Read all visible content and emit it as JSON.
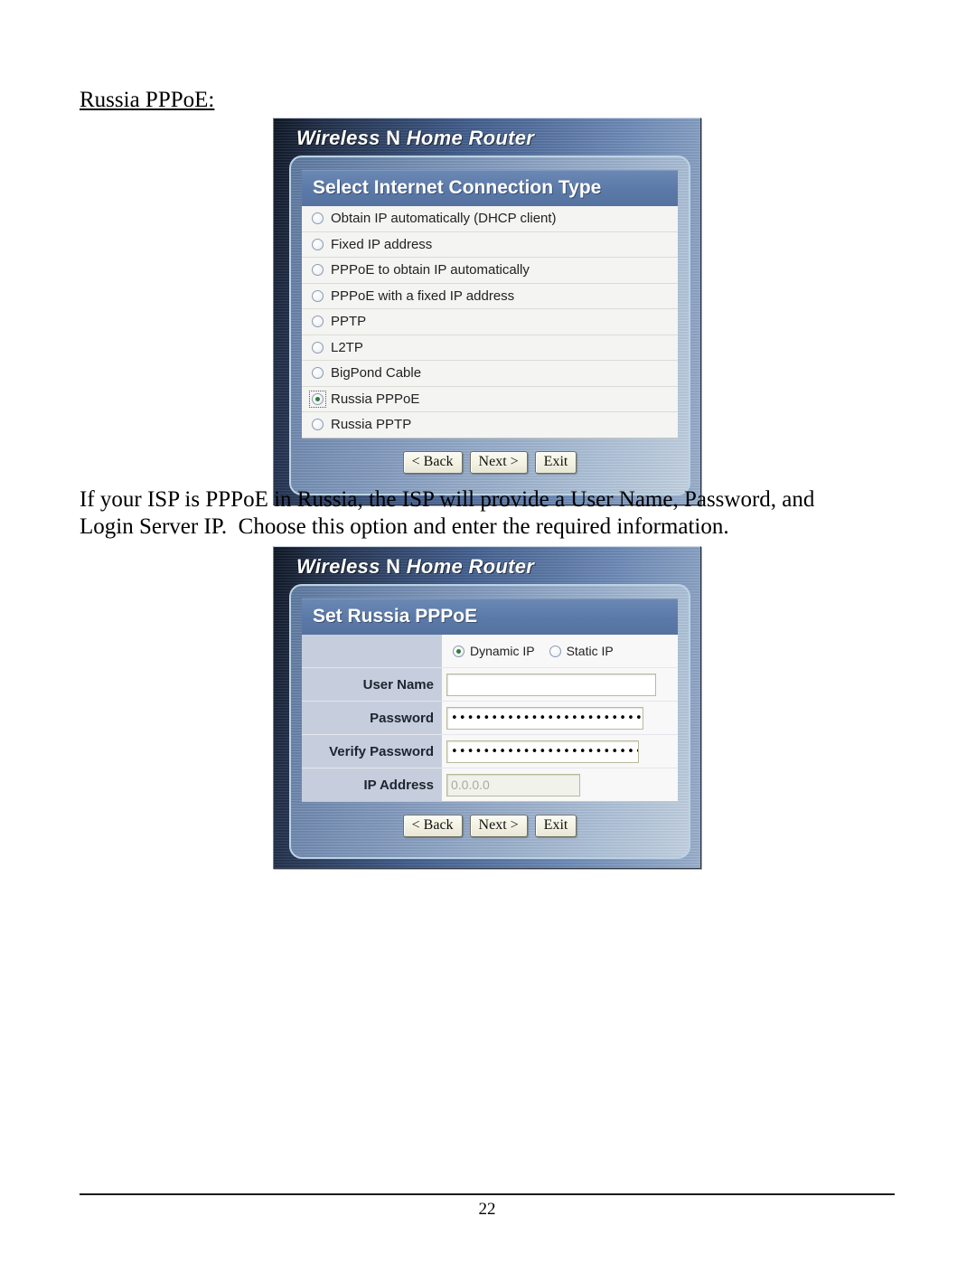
{
  "document": {
    "heading": "Russia PPPoE:",
    "paragraph_lines": [
      "If your ISP is PPPoE in Russia, the ISP will provide a User Name, Password, and",
      "Login Server IP.  Choose this option and enter the required information."
    ],
    "page_number": "22"
  },
  "colors": {
    "panel_header": "#5b79a8",
    "label_column": "#c6cedd",
    "window_dark": "#101826",
    "window_light": "#9db2ce",
    "radio_dot": "#2f7a3c",
    "input_border": "#b9b99a"
  },
  "dialog_connection_type": {
    "brand": {
      "prefix": "Wireless ",
      "n": "N",
      "suffix": " Home Router"
    },
    "panel_title": "Select Internet Connection Type",
    "options": [
      {
        "label": "Obtain IP automatically (DHCP client)",
        "selected": false
      },
      {
        "label": "Fixed IP address",
        "selected": false
      },
      {
        "label": "PPPoE to obtain IP automatically",
        "selected": false
      },
      {
        "label": "PPPoE with a fixed IP address",
        "selected": false
      },
      {
        "label": "PPTP",
        "selected": false
      },
      {
        "label": "L2TP",
        "selected": false
      },
      {
        "label": "BigPond Cable",
        "selected": false
      },
      {
        "label": "Russia PPPoE",
        "selected": true
      },
      {
        "label": "Russia PPTP",
        "selected": false
      }
    ],
    "buttons": {
      "back": "< Back",
      "next": "Next >",
      "exit": "Exit"
    }
  },
  "dialog_set_russia_pppoe": {
    "brand": {
      "prefix": "Wireless ",
      "n": "N",
      "suffix": " Home Router"
    },
    "panel_title": {
      "prefix": "Set Russia PPPo",
      "emphasis": "E"
    },
    "ip_mode": {
      "dynamic_label": "Dynamic IP",
      "dynamic_selected": true,
      "static_label": "Static IP",
      "static_selected": false
    },
    "fields": [
      {
        "label": "User Name",
        "type": "text",
        "value": ""
      },
      {
        "label": "Password",
        "type": "password",
        "masked": "••••••••••••••••••••••••••••"
      },
      {
        "label": "Verify Password",
        "type": "password",
        "masked": "•••••••••••••••••••••••••••"
      },
      {
        "label": "IP Address",
        "type": "text",
        "placeholder": "0.0.0.0",
        "value": ""
      }
    ],
    "buttons": {
      "back": "< Back",
      "next": "Next >",
      "exit": "Exit"
    }
  }
}
